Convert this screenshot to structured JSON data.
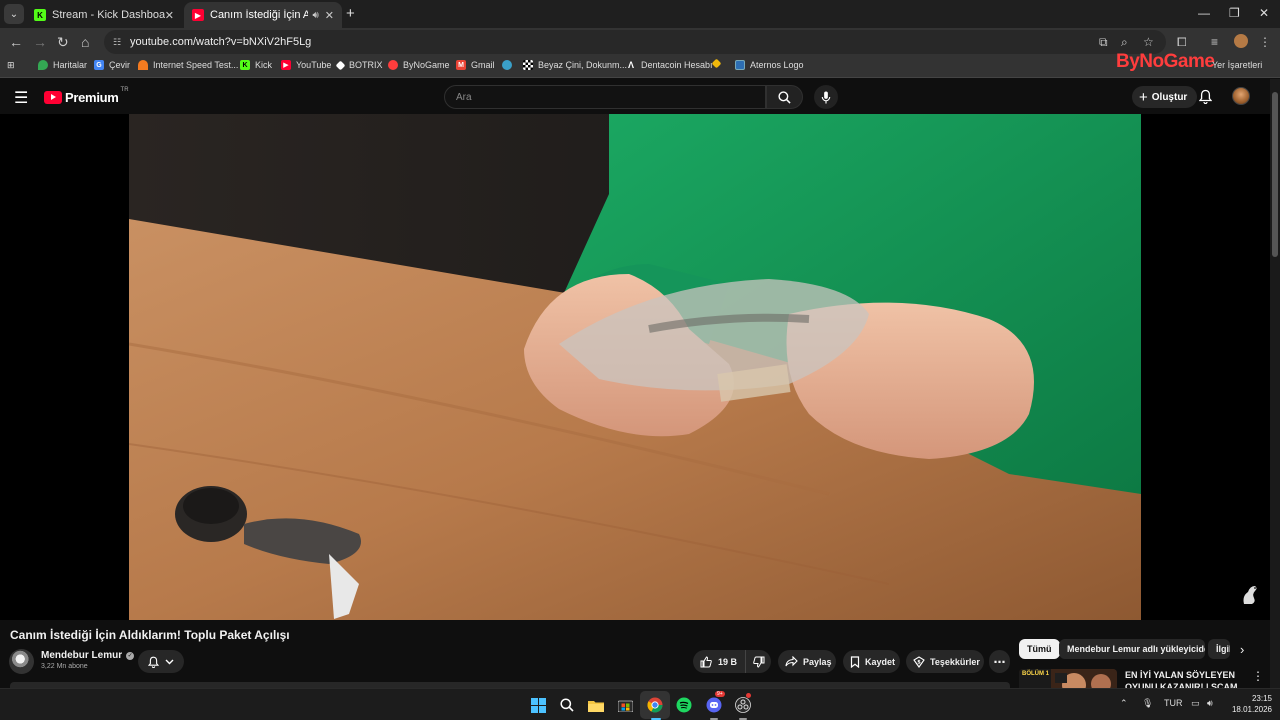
{
  "browser": {
    "tabs": [
      {
        "label": "Stream - Kick Dashboard",
        "active": false
      },
      {
        "label": "Canım İstediği İçin Aldıklarım",
        "active": true
      }
    ],
    "url": "youtube.com/watch?v=bNXiV2hF5Lg",
    "bookmarks": [
      {
        "label": "Haritalar",
        "icon": "maps-icon"
      },
      {
        "label": "Çevir",
        "icon": "translate-icon"
      },
      {
        "label": "Internet Speed Test...",
        "icon": "speedtest-icon"
      },
      {
        "label": "Kick",
        "icon": "kick-icon"
      },
      {
        "label": "YouTube",
        "icon": "youtube-icon"
      },
      {
        "label": "BOTRIX",
        "icon": "botrix-icon"
      },
      {
        "label": "ByNoGame",
        "icon": "bynogame-icon"
      },
      {
        "label": "Gmail",
        "icon": "gmail-icon"
      },
      {
        "label": "",
        "icon": "blue-circle-icon"
      },
      {
        "label": "Beyaz Çini, Dokunm...",
        "icon": "checker-icon"
      },
      {
        "label": "Dentacoin Hesabı",
        "icon": "dentacoin-icon"
      },
      {
        "label": "",
        "icon": "binance-icon"
      },
      {
        "label": "Aternos Logo",
        "icon": "aternos-icon"
      }
    ],
    "other_bookmarks": "Yer İşaretleri",
    "overlay_logo": "ByNoGame"
  },
  "youtube": {
    "logo_text": "Premium",
    "country_code": "TR",
    "search_placeholder": "Ara",
    "create_label": "Oluştur",
    "video_title": "Canım İstediği İçin Aldıklarım! Toplu Paket Açılışı",
    "channel_name": "Mendebur Lemur",
    "subscribers": "3,22 Mn abone",
    "like_count": "19 B",
    "share_label": "Paylaş",
    "save_label": "Kaydet",
    "thanks_label": "Teşekkürler",
    "chips": [
      "Tümü",
      "Mendebur Lemur adlı yükleyiciden",
      "İlgili"
    ],
    "recommendation": {
      "title": "EN İYİ YALAN SÖYLEYEN OYUNU KAZANIR! | SCAM LIN...",
      "thumb_text": "BÖLÜM 1"
    }
  },
  "taskbar": {
    "language": "TUR",
    "time": "23:15",
    "date": "18.01.2026",
    "discord_badge": "9+"
  },
  "colors": {
    "yt_red": "#ff0033",
    "kick_green": "#53fc18",
    "bynogame_red": "#ff3d3d"
  }
}
